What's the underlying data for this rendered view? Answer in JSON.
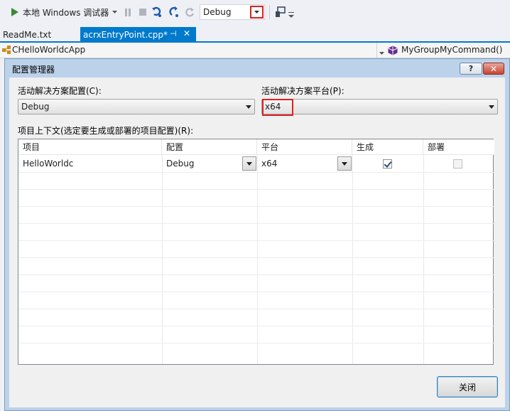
{
  "toolbar": {
    "run_label": "本地 Windows 调试器",
    "config_value": "Debug",
    "icons": [
      "play-icon",
      "pause-icon",
      "stop-icon",
      "step-into-icon",
      "step-over-icon",
      "restart-icon",
      "platform-icon"
    ]
  },
  "tabs": [
    {
      "label": "ReadMe.txt",
      "active": false
    },
    {
      "label": "acrxEntryPoint.cpp*",
      "active": true,
      "pin": "⊣",
      "close": "✕"
    }
  ],
  "navbar": {
    "class_name": "CHelloWorldcApp",
    "member_name": "MyGroupMyCommand()"
  },
  "dialog": {
    "title": "配置管理器",
    "help_label": "?",
    "close_label": "✕",
    "active_config_label": "活动解决方案配置(C):",
    "active_config_value": "Debug",
    "active_platform_label": "活动解决方案平台(P):",
    "active_platform_value": "x64",
    "project_contexts_label": "项目上下文(选定要生成或部署的项目配置)(R):",
    "columns": [
      "项目",
      "配置",
      "平台",
      "生成",
      "部署"
    ],
    "rows": [
      {
        "project": "HelloWorldc",
        "configuration": "Debug",
        "platform": "x64",
        "build": true,
        "deploy": false
      }
    ],
    "close_button": "关闭"
  },
  "colors": {
    "accent": "#007acc",
    "highlight_box": "#e02020",
    "dialog_frame": "#bcd2ea"
  }
}
